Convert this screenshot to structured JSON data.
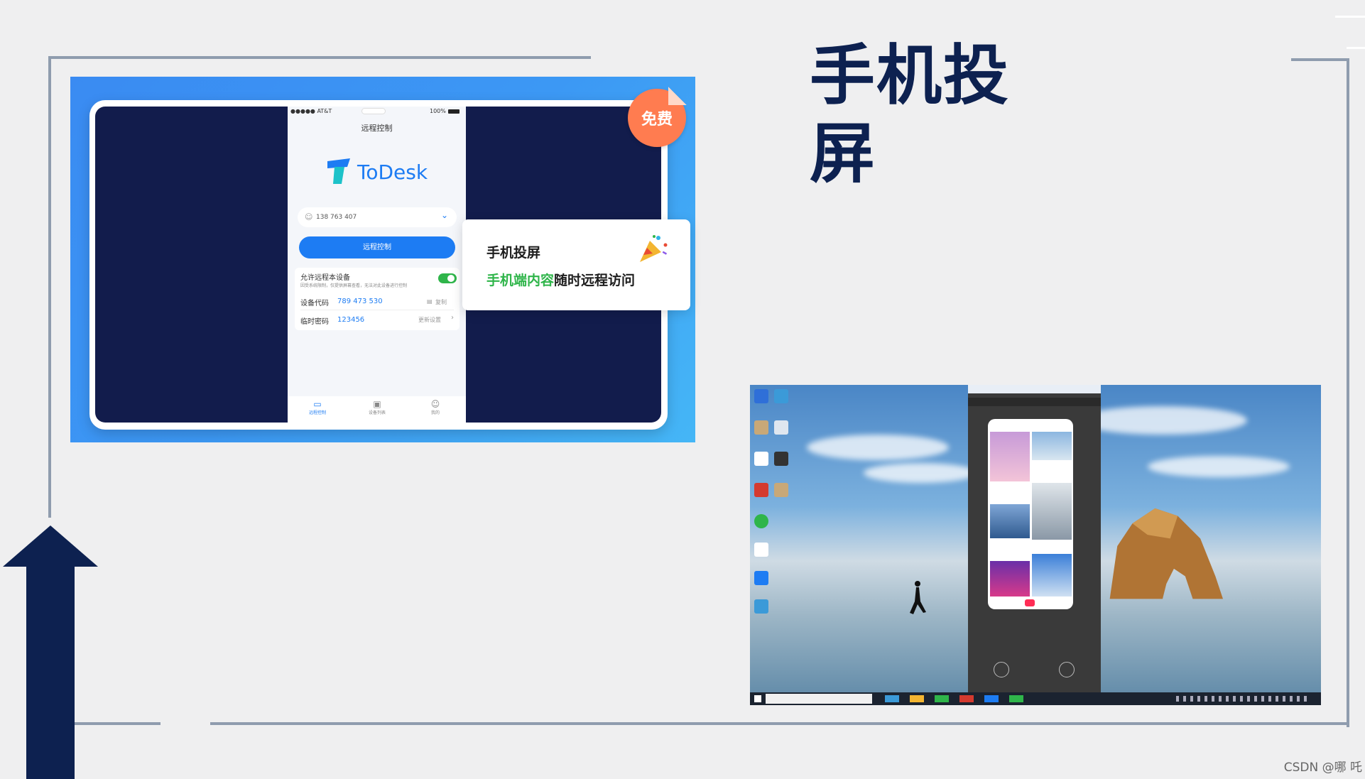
{
  "title": "手机投屏",
  "badge": {
    "free": "免费"
  },
  "phone": {
    "status_carrier": "●●●●● AT&T",
    "status_battery": "100%",
    "header": "远程控制",
    "logo_text": "ToDesk",
    "account_id": "138 763 407",
    "connect_button": "远程控制",
    "allow_label": "允许远程本设备",
    "allow_sub": "因受系统限制，仅提供屏幕查看，无法对此设备进行控制",
    "device_code_label": "设备代码",
    "device_code_value": "789 473 530",
    "copy_label": "复制",
    "temp_pwd_label": "临时密码",
    "temp_pwd_value": "123456",
    "update_label": "更新设置",
    "tabs": [
      "远程控制",
      "设备列表",
      "我的"
    ]
  },
  "promo": {
    "title": "手机投屏",
    "line_green": "手机端内容",
    "line_dark": "随时远程访问"
  },
  "watermark": "CSDN @哪 吒",
  "colors": {
    "navy": "#0d2150",
    "accent_blue": "#2f7cf6",
    "green": "#2fb54a",
    "badge_orange": "#ff7c50"
  }
}
